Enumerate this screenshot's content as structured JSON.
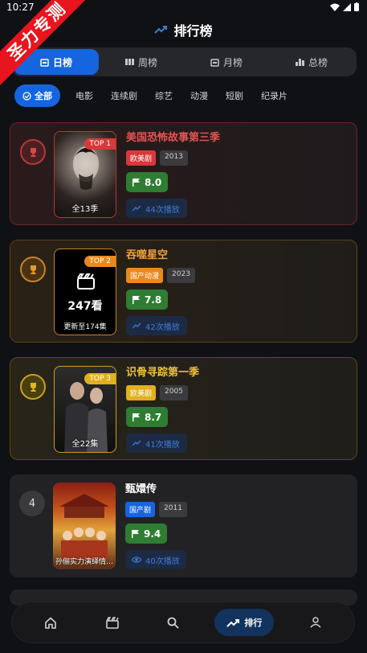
{
  "status": {
    "time": "10:27"
  },
  "ribbon": {
    "text": "圣力专测"
  },
  "header": {
    "title": "排行榜"
  },
  "period_tabs": [
    {
      "label": "日榜",
      "active": true
    },
    {
      "label": "周榜",
      "active": false
    },
    {
      "label": "月榜",
      "active": false
    },
    {
      "label": "总榜",
      "active": false
    }
  ],
  "category_tabs": [
    {
      "label": "全部",
      "active": true
    },
    {
      "label": "电影"
    },
    {
      "label": "连续剧"
    },
    {
      "label": "综艺"
    },
    {
      "label": "动漫"
    },
    {
      "label": "短剧"
    },
    {
      "label": "纪录片"
    }
  ],
  "items": [
    {
      "rank": "1",
      "title": "美国恐怖故事第三季",
      "genre": "欧美剧",
      "genre_color": "#d9383a",
      "year": "2013",
      "score": "8.0",
      "plays": "44次播放",
      "top_tag": "TOP 1",
      "caption": "全13季"
    },
    {
      "rank": "2",
      "title": "吞噬星空",
      "genre": "国产动漫",
      "genre_color": "#e8891e",
      "year": "2023",
      "score": "7.8",
      "plays": "42次播放",
      "top_tag": "TOP 2",
      "views": "247看",
      "caption": "更新至174集"
    },
    {
      "rank": "3",
      "title": "识骨寻踪第一季",
      "genre": "欧美剧",
      "genre_color": "#e0b020",
      "year": "2005",
      "score": "8.7",
      "plays": "41次播放",
      "top_tag": "TOP 3",
      "caption": "全22集"
    },
    {
      "rank": "4",
      "title": "甄嬛传",
      "genre": "国产剧",
      "genre_color": "#1565e0",
      "year": "2011",
      "score": "9.4",
      "plays": "40次播放",
      "caption": "孙俪实力演绎情…"
    }
  ],
  "bottom_nav": [
    {
      "icon": "home-icon",
      "label": ""
    },
    {
      "icon": "clapper-icon",
      "label": ""
    },
    {
      "icon": "search-icon",
      "label": ""
    },
    {
      "icon": "trending-icon",
      "label": "排行",
      "active": true
    },
    {
      "icon": "user-icon",
      "label": ""
    }
  ]
}
